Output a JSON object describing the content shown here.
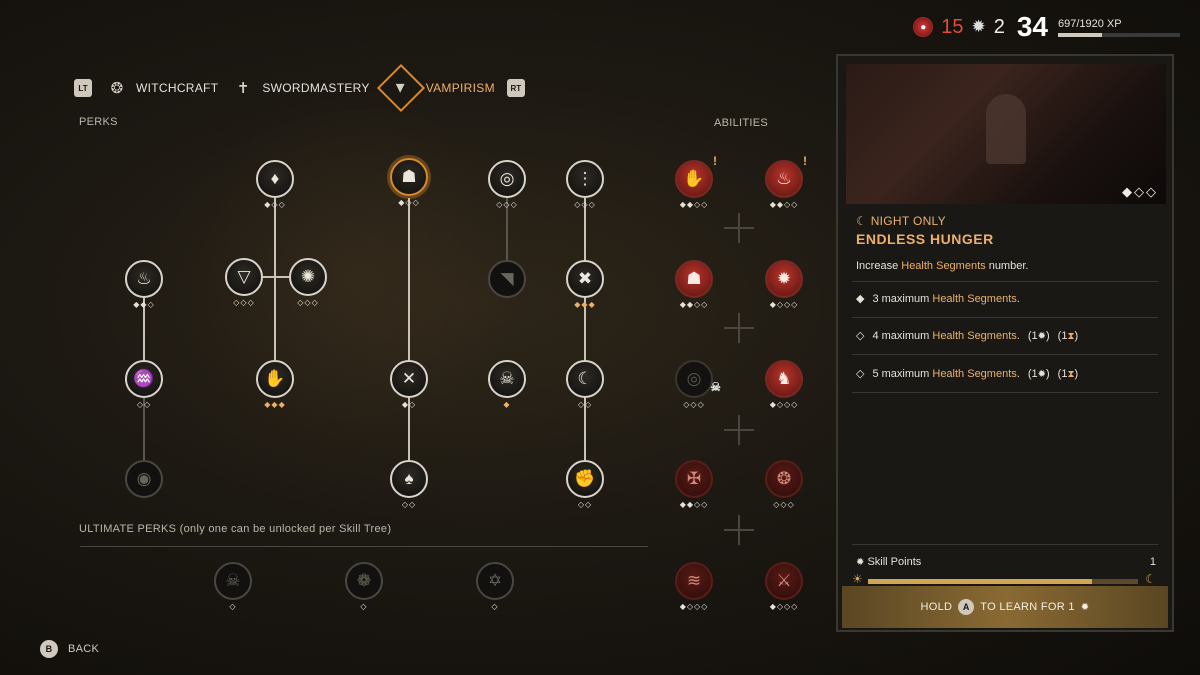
{
  "stats": {
    "red_currency": "15",
    "skill_points": "2",
    "level": "34",
    "xp_text": "697/1920 XP",
    "xp_fraction": 0.363
  },
  "tabs": {
    "left_bumper": "LT",
    "right_bumper": "RT",
    "items": [
      {
        "label": "WITCHCRAFT",
        "icon": "witchcraft-icon"
      },
      {
        "label": "SWORDMASTERY",
        "icon": "swordmastery-icon"
      },
      {
        "label": "VAMPIRISM",
        "icon": "vampirism-icon",
        "active": true
      }
    ]
  },
  "sections": {
    "perks": "PERKS",
    "abilities": "ABILITIES",
    "ultimate": "ULTIMATE PERKS (only one can be unlocked per Skill Tree)"
  },
  "perk_pips": {
    "c1r1": "◆◆◇",
    "c1r2": "◇◇",
    "c1r3": "",
    "c2r0": "◆◇◇",
    "c2r1a": "◇◇◇",
    "c2r1b": "◇◇◇",
    "c2r2": "◆◆◆",
    "c3r0": "◆◇◇",
    "c3r2": "◆◇",
    "c3r3": "◇◇",
    "c4r0": "◇◇◇",
    "c4r1": "",
    "c4r2": "◆",
    "c5r0": "◇◇◇",
    "c5r1": "◆◆◆",
    "c5r2": "◇◇",
    "c5r3": "◇◇"
  },
  "ability_pips": {
    "a1": "◆◆◇◇",
    "a2": "◆◆◇◇",
    "a3": "◆◆◇◇",
    "a4": "◆◇◇◇",
    "a5": "◇◇◇",
    "a6": "◆◇◇◇",
    "a7": "◆◆◇◇",
    "a8": "◇◇◇",
    "a9": "◆◇◇◇",
    "a10": "◆◇◇◇"
  },
  "ultimate_pips": {
    "u1": "◇",
    "u2": "◇",
    "u3": "◇"
  },
  "panel": {
    "preview_pips": "◆◇◇",
    "tag": "☾ NIGHT ONLY",
    "title": "ENDLESS HUNGER",
    "desc_pre": "Increase ",
    "desc_hl": "Health Segments",
    "desc_post": " number.",
    "levels": [
      {
        "marker": "◆",
        "pre": "3 maximum ",
        "hl": "Health Segments",
        "post": ".",
        "cost1": "",
        "cost2": ""
      },
      {
        "marker": "◇",
        "pre": "4 maximum ",
        "hl": "Health Segments",
        "post": ".",
        "cost1": "(1",
        "cost2": "(1"
      },
      {
        "marker": "◇",
        "pre": "5 maximum ",
        "hl": "Health Segments",
        "post": ".",
        "cost1": "(1",
        "cost2": "(1"
      }
    ],
    "skill_points_label": "Skill Points",
    "skill_points_value": "1",
    "day_progress": 0.83,
    "hold_pre": "HOLD",
    "hold_button": "A",
    "hold_post": "TO LEARN FOR 1"
  },
  "back": {
    "button": "B",
    "label": "BACK"
  }
}
